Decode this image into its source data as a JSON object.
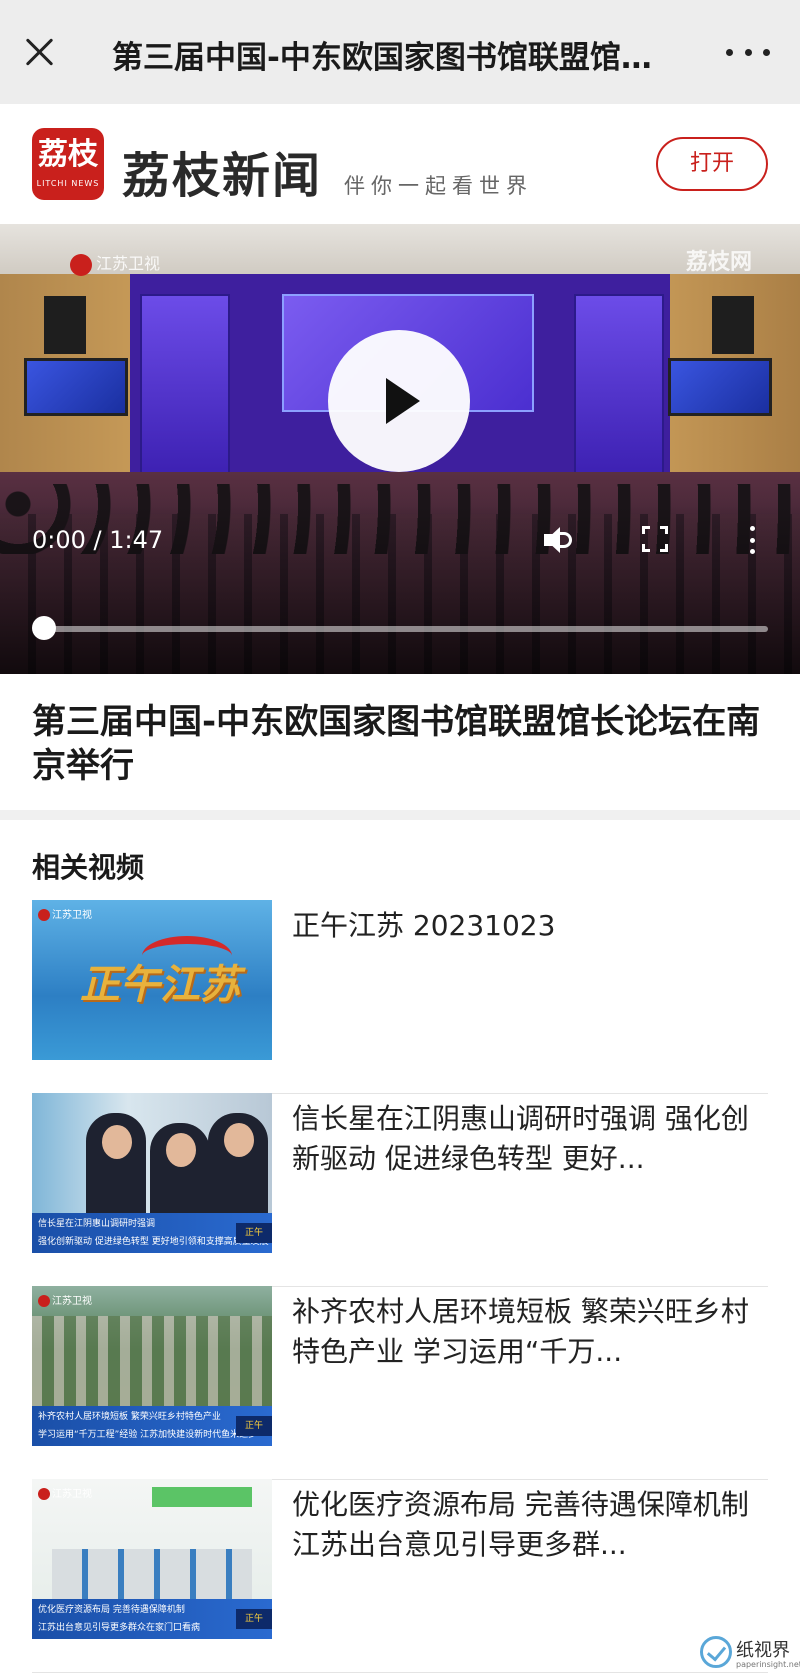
{
  "nav": {
    "title": "第三届中国-中东欧国家图书馆联盟馆长论坛在南京举行",
    "close_icon": "close-icon",
    "more_icon": "more-horizontal-icon"
  },
  "brand": {
    "logo_text": "荔枝",
    "logo_subtext": "LITCHI NEWS",
    "name": "荔枝新闻",
    "slogan": "伴你一起看世界",
    "open_button": "打开",
    "accent_color": "#c9201c"
  },
  "video": {
    "channel_logo": "江苏卫视",
    "watermark": "荔枝网",
    "current_time": "0:00",
    "time_separator": " / ",
    "duration": "1:47",
    "time_display": "0:00 / 1:47",
    "progress": 0,
    "icons": [
      "play-icon",
      "volume-icon",
      "fullscreen-icon",
      "more-vertical-icon"
    ]
  },
  "article": {
    "title": "第三届中国-中东欧国家图书馆联盟馆长论坛在南京举行"
  },
  "related": {
    "heading": "相关视频",
    "items": [
      {
        "title": "正午江苏 20231023",
        "thumb_text": "正午江苏",
        "thumb_channel": "江苏卫视"
      },
      {
        "title": "信长星在江阴惠山调研时强调 强化创新驱动 促进绿色转型 更好...",
        "thumb_channel": "",
        "caption1": "信长星在江阴惠山调研时强调",
        "caption2": "强化创新驱动  促进绿色转型  更好地引领和支撑高质量发展",
        "tag": "正午"
      },
      {
        "title": "补齐农村人居环境短板 繁荣兴旺乡村特色产业 学习运用“千万...",
        "thumb_channel": "江苏卫视",
        "caption1": "补齐农村人居环境短板  繁荣兴旺乡村特色产业",
        "caption2": "学习运用“千万工程”经验  江苏加快建设新时代鱼米之乡",
        "tag": "正午"
      },
      {
        "title": "优化医疗资源布局 完善待遇保障机制 江苏出台意见引导更多群...",
        "thumb_channel": "江苏卫视",
        "caption1": "优化医疗资源布局  完善待遇保障机制",
        "caption2": "江苏出台意见引导更多群众在家门口看病",
        "tag": "正午"
      }
    ]
  },
  "watermark": {
    "name": "纸视界",
    "url": "paperinsight.net"
  }
}
